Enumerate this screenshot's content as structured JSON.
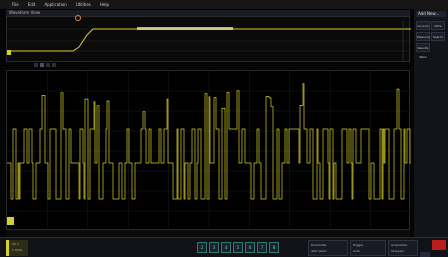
{
  "menu": {
    "items": [
      "File",
      "Edit",
      "Application",
      "Utilities",
      "Help"
    ]
  },
  "overview": {
    "title": "Waveform View"
  },
  "waveform": {
    "channel_label": "1",
    "color": "#d7cf2a"
  },
  "right_panel": {
    "header": "Add New...",
    "buttons": [
      "Cursors",
      "Note",
      "Measure",
      "Search",
      "Results Table"
    ]
  },
  "bottom": {
    "channel_badge": {
      "name": "Ch 1",
      "scale": "1 V/div"
    },
    "channel_keys": [
      "2",
      "3",
      "4",
      "5",
      "6",
      "7",
      "8"
    ],
    "boxes": [
      {
        "line1": "Horizontal",
        "line2": "400 ns/div"
      },
      {
        "line1": "Trigger",
        "line2": "Auto"
      },
      {
        "line1": "Acquisition",
        "line2": "Stopped"
      }
    ],
    "colors": {
      "accent": "#2f7a6a",
      "stop": "#b81e1e"
    }
  }
}
